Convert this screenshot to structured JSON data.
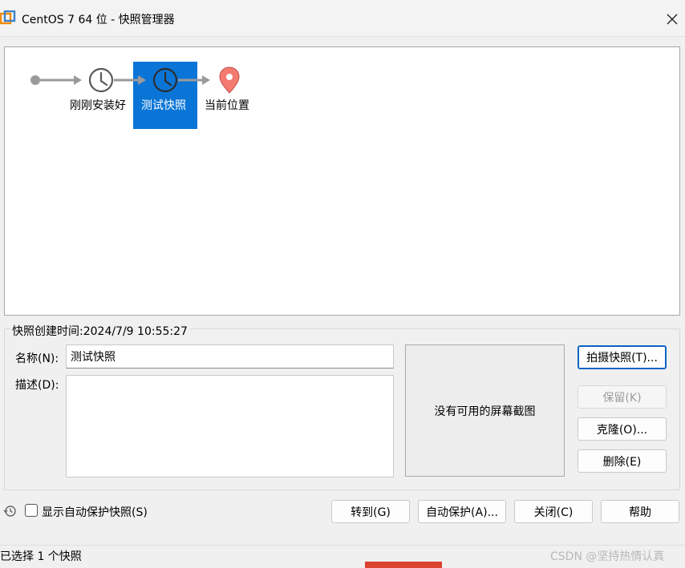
{
  "window": {
    "title": "CentOS 7 64 位 - 快照管理器",
    "close_icon": "close-icon"
  },
  "snapshot_tree": {
    "nodes": [
      {
        "label": "刚刚安装好",
        "icon": "clock-icon"
      },
      {
        "label": "测试快照",
        "icon": "clock-icon",
        "selected": true
      },
      {
        "label": "当前位置",
        "icon": "location-pin-icon"
      }
    ],
    "colors": {
      "selection": "#0a75d6",
      "pin": "#f47a6f",
      "arrow": "#9a9a9a"
    }
  },
  "details": {
    "created_caption": "快照创建时间:2024/7/9 10:55:27",
    "name_label": "名称(N):",
    "name_value": "测试快照",
    "desc_label": "描述(D):",
    "desc_value": "",
    "preview_text": "没有可用的屏幕截图"
  },
  "side_buttons": {
    "take": "拍摄快照(T)...",
    "keep": "保留(K)",
    "clone": "克隆(O)...",
    "delete": "删除(E)"
  },
  "bottom": {
    "show_auto_checkbox": "显示自动保护快照(S)",
    "goto": "转到(G)",
    "autoprotect": "自动保护(A)...",
    "close": "关闭(C)",
    "help": "帮助"
  },
  "status": {
    "selected_count": "已选择 1 个快照",
    "watermark": "CSDN @坚持热情认真"
  }
}
